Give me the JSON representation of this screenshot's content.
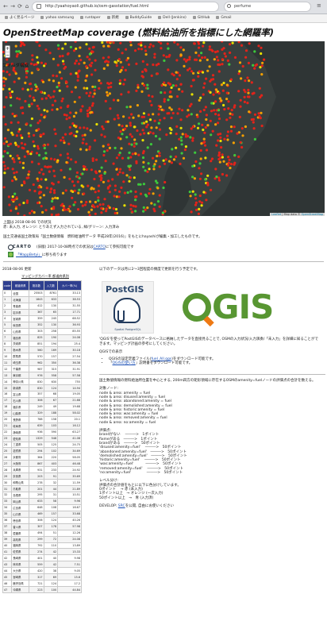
{
  "browser": {
    "back": "←",
    "forward": "→",
    "reload": "⟳",
    "home": "⌂",
    "url": "http://yaahoyaoli.github.io/osm-gasstation/fuel.html",
    "search_placeholder": "perfume",
    "menu": "≡",
    "bookmarks": [
      "よく見るページ",
      "yahoo samsung",
      "runtaper",
      "新規",
      "BuddyGuide",
      "Dell (Jenkins)",
      "GitHub",
      "Gmail"
    ]
  },
  "page": {
    "title": "OpenStreetMap coverage (燃料給油所を指標にした網羅率)"
  },
  "map": {
    "zoom_in": "+",
    "zoom_out": "−",
    "folder_label": "フォルダ構成",
    "attribution_leaflet": "Leaflet",
    "attribution_rest": " | Map data © ",
    "attribution_osm": "OpenStreetMap"
  },
  "notes": {
    "line1": "上図は 2018-08-06 での状況",
    "line2": "赤: 未入力, オレンジ: とりあえず入力されている, 緑/グリーン: 入力済み",
    "source": "国土交通省国土政策局「国土数値情報　燃料給油所データ 平成28年(2016)」をもとにhayashiが編集・加工したものです。"
  },
  "badges": {
    "carto_name": "CARTO",
    "carto_text_pre": "(旧版) 2017-10-08時点での状況は",
    "carto_link": "CARTO",
    "carto_text_post": "にて参照可能です",
    "mapbox_link": "「MappBetyi」",
    "mapbox_text": "に移ち有ります"
  },
  "left": {
    "update": "2018-08-06 更新",
    "table_title": "マッピングカバー率 都道府県別",
    "headers": [
      "code",
      "都道府県",
      "既存数",
      "入力数",
      "カバー率(%)"
    ],
    "rows": [
      [
        "0",
        "全国",
        "25503",
        "8761",
        "33.13"
      ],
      [
        "1",
        "北海道",
        "1843",
        "633",
        "38.53"
      ],
      [
        "2",
        "青森県",
        "412",
        "130",
        "31.55"
      ],
      [
        "3",
        "岩手県",
        "367",
        "65",
        "17.71"
      ],
      [
        "4",
        "宮城県",
        "359",
        "245",
        "68.52"
      ],
      [
        "5",
        "秋田県",
        "352",
        "130",
        "36.93"
      ],
      [
        "6",
        "山形県",
        "303",
        "258",
        "85.55"
      ],
      [
        "7",
        "福島県",
        "825",
        "190",
        "24.08"
      ],
      [
        "8",
        "茨城県",
        "851",
        "194",
        "25.4"
      ],
      [
        "9",
        "栃木県",
        "560",
        "169",
        "30.18"
      ],
      [
        "10",
        "群馬県",
        "570",
        "157",
        "27.54"
      ],
      [
        "11",
        "埼玉県",
        "962",
        "350",
        "36.38"
      ],
      [
        "12",
        "千葉県",
        "987",
        "315",
        "31.91"
      ],
      [
        "13",
        "東京都",
        "976",
        "558",
        "57.58"
      ],
      [
        "14",
        "神奈川県",
        "830",
        "630",
        "755"
      ],
      [
        "15",
        "新潟県",
        "830",
        "124",
        "14.94"
      ],
      [
        "16",
        "富山県",
        "357",
        "68",
        "19.05"
      ],
      [
        "17",
        "石川県",
        "306",
        "67",
        "21.68"
      ],
      [
        "18",
        "福井県",
        "249",
        "49",
        "19.68"
      ],
      [
        "19",
        "山梨県",
        "329",
        "188",
        "58.02"
      ],
      [
        "20",
        "長野県",
        "788",
        "158",
        "20.1"
      ],
      [
        "21",
        "岐阜県",
        "639",
        "103",
        "16.12"
      ],
      [
        "22",
        "静岡県",
        "936",
        "590",
        "63.27"
      ],
      [
        "23",
        "愛知県",
        "1329",
        "548",
        "41.08"
      ],
      [
        "24",
        "三重県",
        "505",
        "125",
        "24.75"
      ],
      [
        "25",
        "滋賀県",
        "294",
        "102",
        "34.69"
      ],
      [
        "26",
        "京都府",
        "364",
        "220",
        "58.05"
      ],
      [
        "27",
        "大阪府",
        "867",
        "403",
        "46.48"
      ],
      [
        "28",
        "兵庫県",
        "931",
        "233",
        "24.92"
      ],
      [
        "29",
        "奈良県",
        "203",
        "91",
        "35.69"
      ],
      [
        "30",
        "和歌山県",
        "278",
        "32",
        "11.59"
      ],
      [
        "31",
        "鳥取県",
        "201",
        "44",
        "21.89"
      ],
      [
        "32",
        "島根県",
        "295",
        "31",
        "10.51"
      ],
      [
        "33",
        "岡山県",
        "633",
        "58",
        "9.96"
      ],
      [
        "34",
        "広島県",
        "648",
        "108",
        "16.67"
      ],
      [
        "35",
        "山口県",
        "469",
        "157",
        "33.68"
      ],
      [
        "36",
        "徳島県",
        "306",
        "124",
        "40.26"
      ],
      [
        "37",
        "香川県",
        "307",
        "178",
        "57.98"
      ],
      [
        "38",
        "愛媛県",
        "494",
        "51",
        "12.26"
      ],
      [
        "39",
        "高知県",
        "299",
        "72",
        "24.08"
      ],
      [
        "40",
        "福岡県",
        "792",
        "110",
        "13.89"
      ],
      [
        "41",
        "佐賀県",
        "274",
        "42",
        "15.33"
      ],
      [
        "42",
        "長崎県",
        "401",
        "40",
        "9.98"
      ],
      [
        "43",
        "熊本県",
        "559",
        "42",
        "7.51"
      ],
      [
        "44",
        "大分県",
        "420",
        "38",
        "9.05"
      ],
      [
        "45",
        "宮崎県",
        "317",
        "69",
        "15.6"
      ],
      [
        "46",
        "鹿児島県",
        "721",
        "124",
        "17.2"
      ],
      [
        "47",
        "沖縄県",
        "223",
        "100",
        "44.84"
      ]
    ]
  },
  "right": {
    "intro": "以下のデータは月に2〜3回程度の頻度で更新を行う予定です。",
    "postgis_word": "PostGIS",
    "postgis_sub": "Spatial PostgreSQL",
    "qgis_word": "GIS",
    "p1": "'QGIS'を使ってPostGISのデータベースに格納したデータを直接見ることで, OSMの入力状況/入力演奏/「未入力」を詳細に知ることができます。マッピング計画の参考にしてください。",
    "p2": "QGISでの表示",
    "li1_pre": "QGISの設定定義ファイル(",
    "li1_link": "fuel_All.qgs",
    "li1_post": ")をダウンロード可能です。",
    "li2_pre": "「",
    "li2_link": "QGISの使い方",
    "li2_post": "」説明書をダウンロード可能です。",
    "p3": "国土数値情報の燃料給油所位置を中心とする, 200m四方の矩形領域に存在するOSMのamenity=fuelノードの評価点の合計を数える。",
    "block1": "対象ノード:\nnode & area: amenity = fuel\nnode & area: disused:amenity = fuel\nnode & area: abandoned:amenity = fuel\nnode & area: demolished:amenity = fuel\nnode & area: historic:amenity = fuel\nnode & area: was:amenity = fuel\nnode & area: removed:amenity = fuel\nnode & area: no:amenity = fuel",
    "block2": "評価点:\nbrandがない　 ―――>　1ポイント\nfixmeがある　―――>　1ポイント\nbrandがある　―――>　50ポイント\n'disused:amenity=fuel'　 ―――>　50ポイント\n'abandoned:amenity=fuel'　―――>　50ポイント\n'demolished:amenity=fuel'　―――>　50ポイント\n'historic:amenity=fuel'　 ―――>　50ポイント\n'was:amenity=fuel'　　　 ―――>　50ポイント\n'removed:amenity=fuel'　 ―――>　50ポイント\n'no:amenity=fuel'　　　　 ―――>　50ポイント",
    "block3": "レベル分け:\n評価点の合計値をもとに以下に色分けしています。\n0ポイント　 → 赤 (未入力)\n1ポイント以上　→ オレンジ (一次入力)\n50ポイント以上　→　青 (入力済)",
    "dev_pre": "DEVELOP: ",
    "dev_link": "SRC",
    "dev_post": "を公開, 自由にお使いください"
  },
  "colors": {
    "red": "#e2231a",
    "orange": "#f5a000",
    "yellow": "#e8e000",
    "green": "#3cc83c",
    "header_blue": "#2e3f8f"
  }
}
